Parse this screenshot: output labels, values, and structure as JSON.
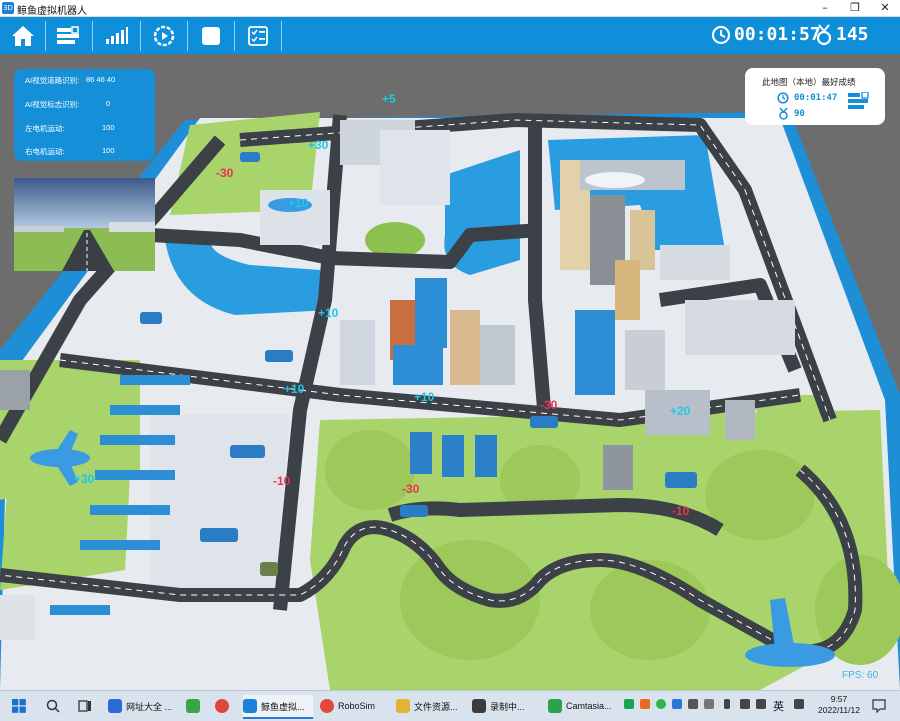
{
  "window": {
    "app_icon_text": "3D",
    "title": "鲸鱼虚拟机器人",
    "minimize_glyph": "–",
    "restore_glyph": "❐",
    "close_glyph": "✕"
  },
  "toolbar": {
    "buttons": [
      {
        "name": "home",
        "icon": "home-icon"
      },
      {
        "name": "bars",
        "icon": "progress-bars-icon"
      },
      {
        "name": "signal",
        "icon": "signal-icon"
      },
      {
        "name": "play-settings",
        "icon": "play-gear-icon"
      },
      {
        "name": "stop",
        "icon": "stop-square-icon"
      },
      {
        "name": "checklist",
        "icon": "checklist-icon"
      }
    ],
    "timer": "00:01:57",
    "coins": "145"
  },
  "ai_panel": {
    "rows": [
      {
        "label": "AI视觉道路识别:",
        "value": "86   46   40"
      },
      {
        "label": "AI视觉标志识别:",
        "value": "0"
      },
      {
        "label": "左电机运动:",
        "value": "100"
      },
      {
        "label": "右电机运动:",
        "value": "100"
      }
    ]
  },
  "best_score": {
    "heading": "此地图（本地）最好成绩",
    "time": "00:01:47",
    "coins": "90"
  },
  "map_labels": [
    {
      "text": "+5",
      "kind": "plus"
    },
    {
      "text": "+30",
      "kind": "plus"
    },
    {
      "text": "-30",
      "kind": "minus"
    },
    {
      "text": "+10",
      "kind": "plus"
    },
    {
      "text": "+10",
      "kind": "plus"
    },
    {
      "text": "+10",
      "kind": "plus"
    },
    {
      "text": "+10",
      "kind": "plus"
    },
    {
      "text": "-30",
      "kind": "minus"
    },
    {
      "text": "+20",
      "kind": "plus"
    },
    {
      "text": "+30",
      "kind": "plus"
    },
    {
      "text": "-10",
      "kind": "minus"
    },
    {
      "text": "-30",
      "kind": "minus"
    },
    {
      "text": "-10",
      "kind": "minus"
    }
  ],
  "fps": "FPS: 60",
  "taskbar": {
    "items": [
      {
        "label": "网址大全 ...",
        "color": "#2c6bd6"
      },
      {
        "label": "",
        "color": "#3aa645"
      },
      {
        "label": "",
        "color": "#e0463a"
      },
      {
        "label": "鲸鱼虚拟...",
        "color": "#1e7fd8"
      },
      {
        "label": "RoboSim",
        "color": "#e04a3c"
      },
      {
        "label": "文件资源...",
        "color": "#e5b331"
      },
      {
        "label": "录制中...",
        "color": "#3c3c3c"
      },
      {
        "label": "Camtasia...",
        "color": "#2fa04b"
      }
    ],
    "ime": "英",
    "time": "9:57",
    "date": "2022/11/12"
  }
}
